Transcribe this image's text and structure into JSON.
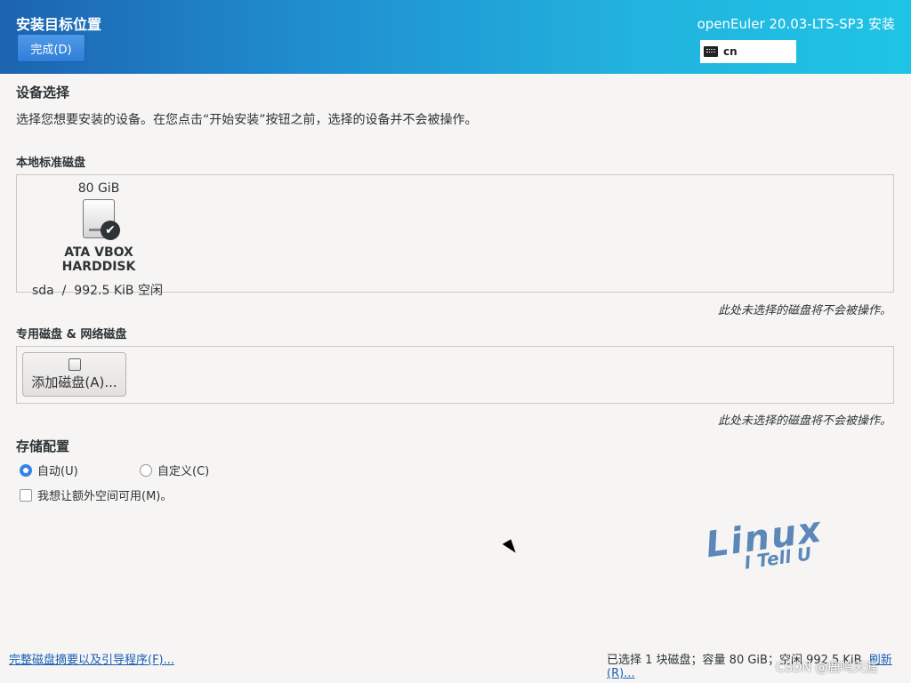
{
  "header": {
    "title": "安装目标位置",
    "done_label": "完成(D)",
    "product": "openEuler 20.03-LTS-SP3 安装",
    "keyboard": "cn"
  },
  "device_selection": {
    "title": "设备选择",
    "description": "选择您想要安装的设备。在您点击“开始安装”按钮之前，选择的设备并不会被操作。"
  },
  "local_disks": {
    "title": "本地标准磁盘",
    "disks": [
      {
        "size": "80 GiB",
        "name": "ATA VBOX HARDDISK",
        "device": "sda",
        "separator": "/",
        "free": "992.5 KiB 空闲"
      }
    ],
    "hint": "此处未选择的磁盘将不会被操作。"
  },
  "special_disks": {
    "title": "专用磁盘 & 网络磁盘",
    "add_label": "添加磁盘(A)...",
    "hint": "此处未选择的磁盘将不会被操作。"
  },
  "storage": {
    "title": "存储配置",
    "auto_label": "自动(U)",
    "custom_label": "自定义(C)",
    "extra_space_label": "我想让额外空间可用(M)。"
  },
  "footer": {
    "summary_link": "完整磁盘摘要以及引导程序(F)...",
    "status": "已选择 1 块磁盘；容量 80 GiB；空闲 992.5 KiB",
    "refresh_label": "刷新(R)...",
    "watermark": "CSDN @鹿鸣天涯"
  },
  "logo": {
    "line1": "Linux",
    "line2": "I Tell U"
  }
}
